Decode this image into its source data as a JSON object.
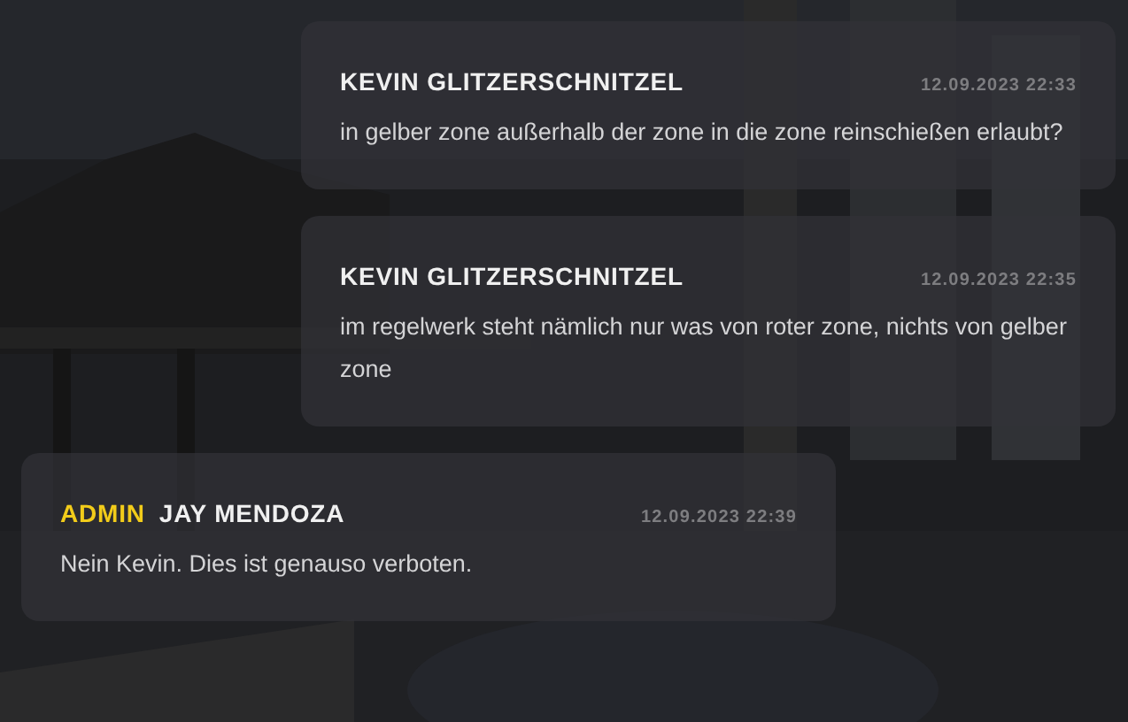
{
  "messages": [
    {
      "kind": "user",
      "author": "KEVIN GLITZERSCHNITZEL",
      "time": "12.09.2023 22:33",
      "text": "in gelber zone außerhalb der zone in die zone reinschießen erlaubt?"
    },
    {
      "kind": "user",
      "author": "KEVIN GLITZERSCHNITZEL",
      "time": "12.09.2023 22:35",
      "text": "im regelwerk steht nämlich nur was von roter zone, nichts von gelber zone"
    },
    {
      "kind": "admin",
      "role": "ADMIN",
      "author": "JAY MENDOZA",
      "time": "12.09.2023 22:39",
      "text": "Nein Kevin. Dies ist genauso verboten."
    }
  ]
}
